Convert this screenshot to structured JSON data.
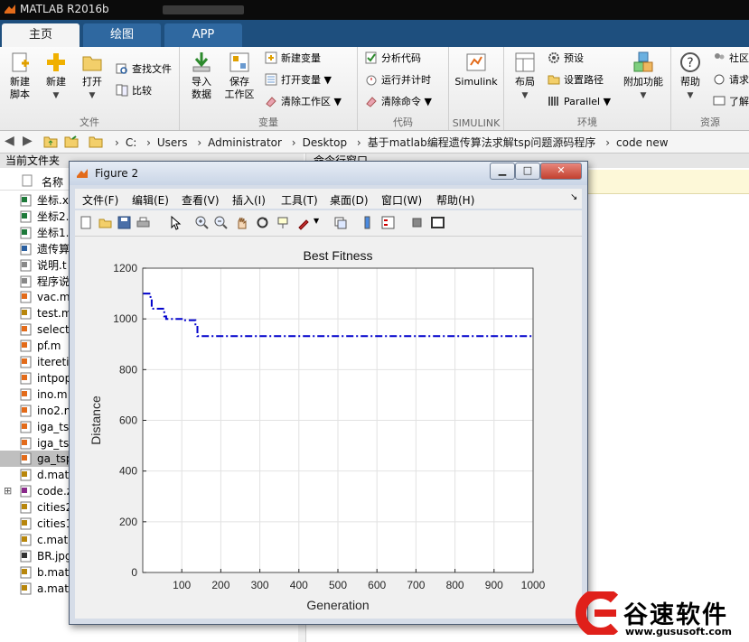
{
  "window": {
    "title": "MATLAB R2016b"
  },
  "ribbon_tabs": [
    {
      "label": "主页"
    },
    {
      "label": "绘图"
    },
    {
      "label": "APP"
    }
  ],
  "ribbon": {
    "file_group": {
      "label": "文件",
      "new_script": "新建\n脚本",
      "new": "新建",
      "open": "打开",
      "find_files": "查找文件",
      "compare": "比较"
    },
    "variable_group": {
      "label": "变量",
      "import": "导入\n数据",
      "save_ws": "保存\n工作区",
      "new_var": "新建变量",
      "open_var": "打开变量",
      "clear_ws": "清除工作区"
    },
    "code_group": {
      "label": "代码",
      "analyze": "分析代码",
      "run_time": "运行并计时",
      "clear_cmd": "清除命令"
    },
    "simulink_group": {
      "label": "SIMULINK",
      "simulink": "Simulink"
    },
    "env_group": {
      "label": "环境",
      "layout": "布局",
      "prefs": "预设",
      "set_path": "设置路径",
      "parallel": "Parallel",
      "addons": "附加功能"
    },
    "resources_group": {
      "label": "资源",
      "help": "帮助",
      "community": "社区",
      "request": "请求",
      "learn": "了解"
    }
  },
  "address_bar": {
    "crumbs": [
      "C:",
      "Users",
      "Administrator",
      "Desktop",
      "基于matlab编程遗传算法求解tsp问题源码程序",
      "code new"
    ]
  },
  "file_panel": {
    "title": "当前文件夹",
    "col_name": "名称",
    "files": [
      {
        "name": "坐标.x",
        "type": "xls"
      },
      {
        "name": "坐标2.",
        "type": "xls"
      },
      {
        "name": "坐标1.",
        "type": "xls"
      },
      {
        "name": "遗传算",
        "type": "doc"
      },
      {
        "name": "说明.t",
        "type": "txt"
      },
      {
        "name": "程序说",
        "type": "txt"
      },
      {
        "name": "vac.m",
        "type": "m"
      },
      {
        "name": "test.m",
        "type": "mat"
      },
      {
        "name": "select",
        "type": "m"
      },
      {
        "name": "pf.m",
        "type": "m"
      },
      {
        "name": "iteretio",
        "type": "m"
      },
      {
        "name": "intpop",
        "type": "m"
      },
      {
        "name": "ino.m",
        "type": "m"
      },
      {
        "name": "ino2.m",
        "type": "m"
      },
      {
        "name": "iga_ts",
        "type": "m"
      },
      {
        "name": "iga_ts",
        "type": "m"
      },
      {
        "name": "ga_tsp",
        "type": "m",
        "selected": true
      },
      {
        "name": "d.mat",
        "type": "mat"
      },
      {
        "name": "code.z",
        "type": "zip"
      },
      {
        "name": "cities2",
        "type": "mat"
      },
      {
        "name": "cities1",
        "type": "mat"
      },
      {
        "name": "c.mat",
        "type": "mat"
      },
      {
        "name": "BR.jpg",
        "type": "jpg"
      },
      {
        "name": "b.mat",
        "type": "mat"
      },
      {
        "name": "a.mat",
        "type": "mat"
      }
    ]
  },
  "command_panel": {
    "title": "命令行窗口"
  },
  "figure": {
    "title": "Figure 2",
    "menus": [
      "文件(F)",
      "编辑(E)",
      "查看(V)",
      "插入(I)",
      "工具(T)",
      "桌面(D)",
      "窗口(W)",
      "帮助(H)"
    ],
    "toolbar": [
      "new-figure-icon",
      "open-icon",
      "save-icon",
      "print-icon",
      "pointer-icon",
      "zoom-in-icon",
      "zoom-out-icon",
      "pan-icon",
      "rotate-icon",
      "data-cursor-icon",
      "brush-icon",
      "link-icon",
      "colorbar-icon",
      "legend-icon",
      "hide-tools-icon",
      "show-tools-icon"
    ]
  },
  "chart_data": {
    "type": "line",
    "title": "Best Fitness",
    "xlabel": "Generation",
    "ylabel": "Distance",
    "xlim": [
      0,
      1000
    ],
    "ylim": [
      0,
      1200
    ],
    "xticks": [
      100,
      200,
      300,
      400,
      500,
      600,
      700,
      800,
      900,
      1000
    ],
    "yticks": [
      0,
      200,
      400,
      600,
      800,
      1000,
      1200
    ],
    "grid": true,
    "line_color": "#0000cc",
    "line_style": "dash-dot",
    "series": [
      {
        "x": [
          1,
          20,
          20,
          23,
          23,
          55,
          55,
          60,
          60,
          100,
          100,
          135,
          135,
          140,
          140,
          1000
        ],
        "y": [
          1100,
          1100,
          1080,
          1080,
          1040,
          1040,
          1010,
          1010,
          1000,
          1000,
          995,
          995,
          975,
          975,
          932,
          932
        ]
      }
    ]
  },
  "watermark": {
    "brand": "谷速软件",
    "url": "www.gususoft.com"
  },
  "colors": {
    "ribbon_tab_bg": "#1e4f7e",
    "accent": "#e0201a",
    "plot_line": "#0000cc"
  }
}
